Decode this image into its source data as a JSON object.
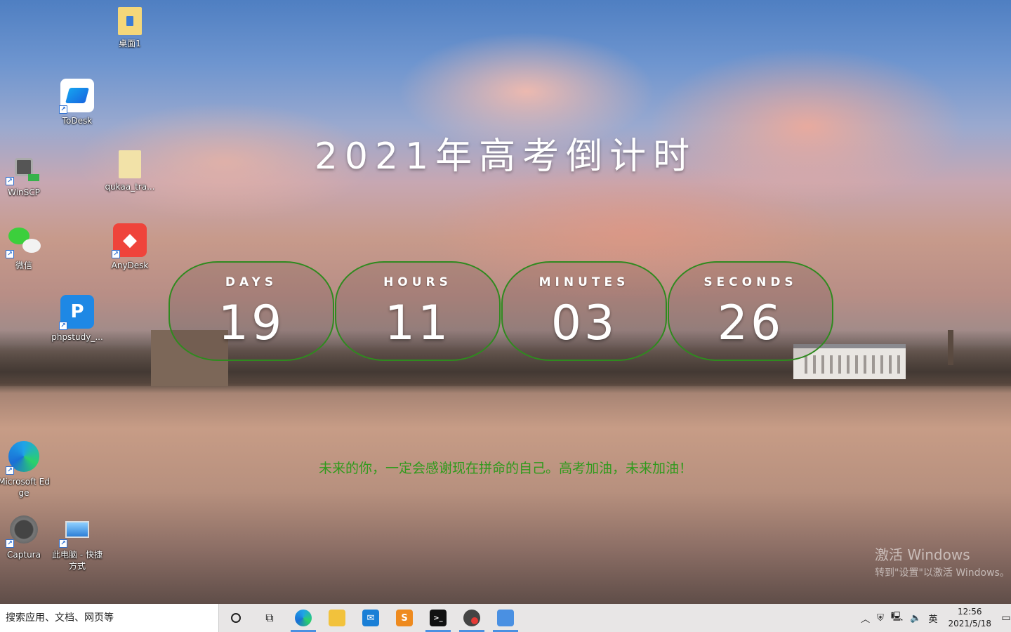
{
  "desktop": {
    "icons": [
      {
        "label": "桌面1"
      },
      {
        "label": "ToDesk"
      },
      {
        "label": "WinSCP"
      },
      {
        "label": "qukaa_tra..."
      },
      {
        "label": "微信"
      },
      {
        "label": "AnyDesk"
      },
      {
        "label": "phpstudy_..."
      },
      {
        "label": "Microsoft Edge"
      },
      {
        "label": "Captura"
      },
      {
        "label": "此电脑 - 快捷方式"
      }
    ]
  },
  "countdown": {
    "title": "2021年高考倒计时",
    "units": [
      {
        "label": "DAYS",
        "value": "19"
      },
      {
        "label": "HOURS",
        "value": "11"
      },
      {
        "label": "MINUTES",
        "value": "03"
      },
      {
        "label": "SECONDS",
        "value": "26"
      }
    ],
    "slogan": "未来的你，一定会感谢现在拼命的自己。高考加油，未来加油！",
    "ring_color": "#2f8a1f",
    "slogan_color": "#2f9a1c"
  },
  "watermark": {
    "line1": "激活 Windows",
    "line2": "转到\"设置\"以激活 Windows。"
  },
  "taskbar": {
    "search_placeholder": "搜索应用、文档、网页等",
    "ime": "英",
    "time": "12:56",
    "date": "2021/5/18"
  }
}
